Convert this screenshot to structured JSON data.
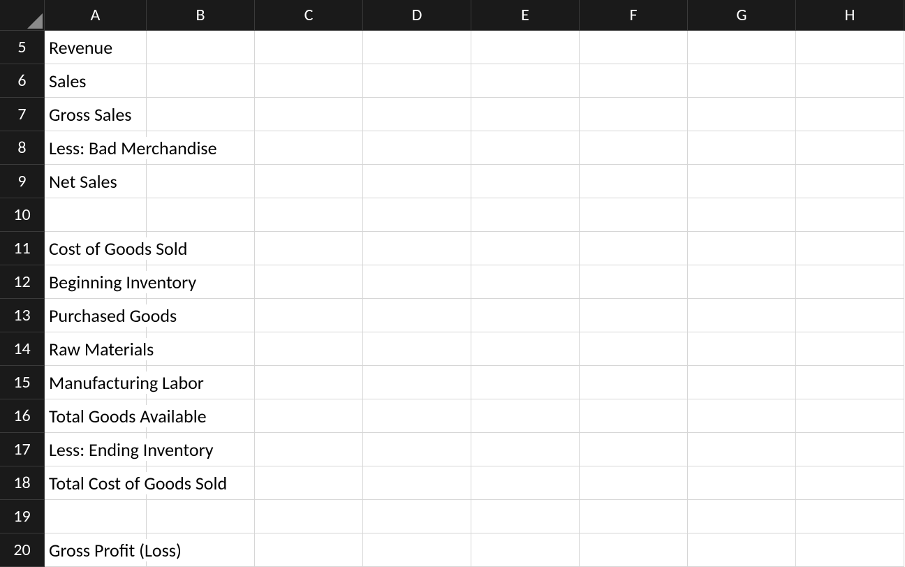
{
  "columns": [
    "A",
    "B",
    "C",
    "D",
    "E",
    "F",
    "G",
    "H"
  ],
  "rows": [
    {
      "num": 5,
      "A": "Revenue"
    },
    {
      "num": 6,
      "A": "Sales"
    },
    {
      "num": 7,
      "A": "Gross Sales"
    },
    {
      "num": 8,
      "A": "Less: Bad Merchandise"
    },
    {
      "num": 9,
      "A": "Net Sales"
    },
    {
      "num": 10,
      "A": ""
    },
    {
      "num": 11,
      "A": "Cost of Goods Sold"
    },
    {
      "num": 12,
      "A": "Beginning Inventory"
    },
    {
      "num": 13,
      "A": "Purchased Goods"
    },
    {
      "num": 14,
      "A": "Raw Materials"
    },
    {
      "num": 15,
      "A": "Manufacturing Labor"
    },
    {
      "num": 16,
      "A": "Total Goods Available"
    },
    {
      "num": 17,
      "A": "Less: Ending Inventory"
    },
    {
      "num": 18,
      "A": "Total Cost of Goods Sold"
    },
    {
      "num": 19,
      "A": ""
    },
    {
      "num": 20,
      "A": "Gross Profit (Loss)"
    }
  ]
}
